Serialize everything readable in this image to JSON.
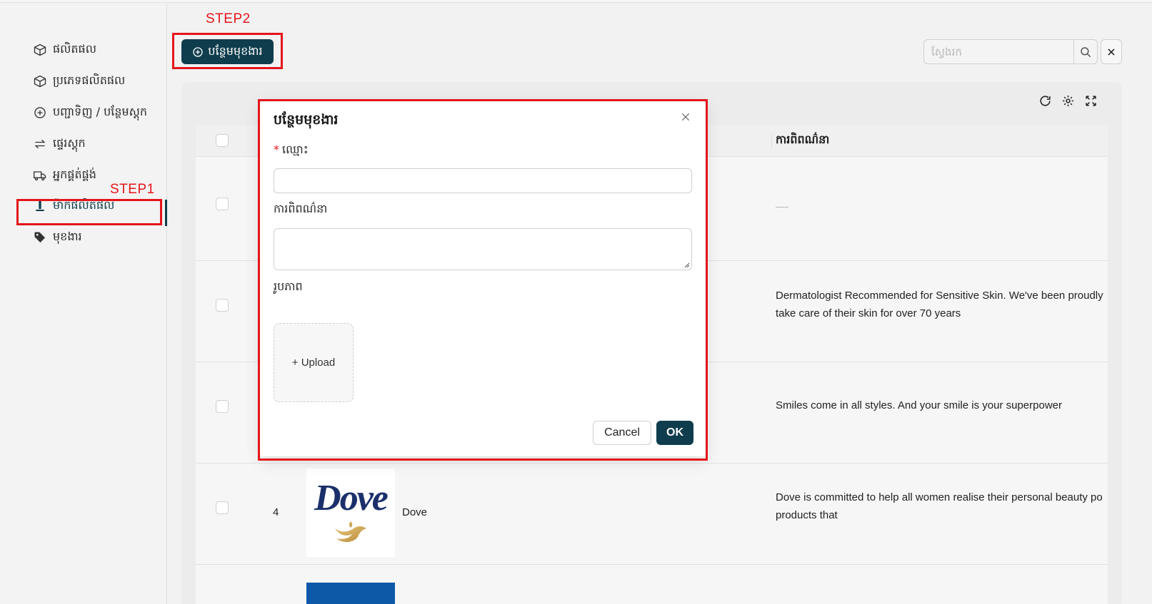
{
  "sidebar": {
    "items": [
      {
        "label": "ផលិតផល",
        "icon": "box-icon"
      },
      {
        "label": "ប្រភេទផលិតផល",
        "icon": "box-icon"
      },
      {
        "label": "បញ្ជាទិញ / បន្ថែមស្តុក",
        "icon": "plus-circle-icon"
      },
      {
        "label": "ផ្ទេរស្តុក",
        "icon": "transfer-icon"
      },
      {
        "label": "អ្នកផ្គត់ផ្គង់",
        "icon": "truck-icon"
      },
      {
        "label": "ម៉ាកផលិតផល",
        "icon": "brand-icon",
        "active": true
      },
      {
        "label": "មុខងារ",
        "icon": "tag-icon"
      }
    ]
  },
  "annotations": {
    "step1": "STEP1",
    "step2": "STEP2",
    "color": "#e5141b"
  },
  "toolbar": {
    "add_label": "បន្ថែមមុខងារ",
    "search_placeholder": "ស្វែងរក"
  },
  "table": {
    "columns": {
      "description": "ការពិពណ៌នា"
    },
    "rows": [
      {
        "description": "—"
      },
      {
        "description_lines": [
          "Dermatologist Recommended for Sensitive Skin. We've been proudly",
          "take care of their skin for over 70 years"
        ]
      },
      {
        "description_lines": [
          "Smiles come in all styles. And your smile is your superpower"
        ]
      },
      {
        "index": "4",
        "name": "Dove",
        "logo_text": "Dove",
        "description_lines": [
          "Dove is committed to help all women realise their personal beauty po",
          "products that"
        ]
      }
    ]
  },
  "modal": {
    "title": "បន្ថែមមុខងារ",
    "name_label": "ឈ្មោះ",
    "required_mark": "*",
    "description_label": "ការពិពណ៌នា",
    "image_label": "រូបភាព",
    "upload_label": "+ Upload",
    "cancel_label": "Cancel",
    "ok_label": "OK"
  },
  "colors": {
    "primary": "#0f3d4d",
    "annotation_red": "#e5141b",
    "dove_blue": "#1b2f6a"
  }
}
